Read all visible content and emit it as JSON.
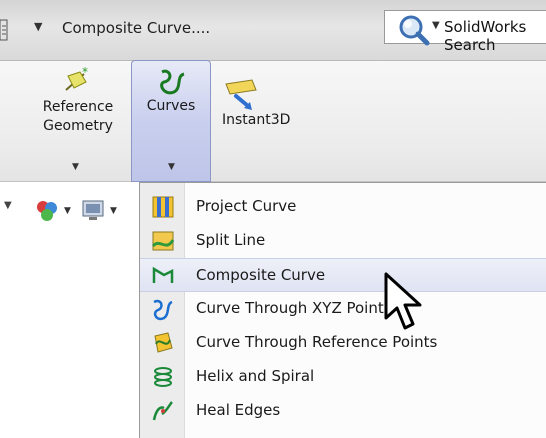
{
  "titlebar": {
    "document_title": "Composite Curve....",
    "search_label": "SolidWorks Search"
  },
  "ribbon": {
    "reference_geometry": "Reference Geometry",
    "curves": "Curves",
    "instant3d": "Instant3D"
  },
  "menu": {
    "items": [
      {
        "label": "Project Curve",
        "icon": "project-curve-icon"
      },
      {
        "label": "Split Line",
        "icon": "split-line-icon"
      },
      {
        "label": "Composite Curve",
        "icon": "composite-curve-icon",
        "highlighted": true
      },
      {
        "label": "Curve Through XYZ Points",
        "icon": "curve-xyz-icon"
      },
      {
        "label": "Curve Through Reference Points",
        "icon": "curve-ref-points-icon"
      },
      {
        "label": "Helix and Spiral",
        "icon": "helix-icon"
      },
      {
        "label": "Heal Edges",
        "icon": "heal-edges-icon"
      }
    ]
  },
  "colors": {
    "highlight": "#dfe3f3",
    "curves_button": "#c9cfee"
  }
}
